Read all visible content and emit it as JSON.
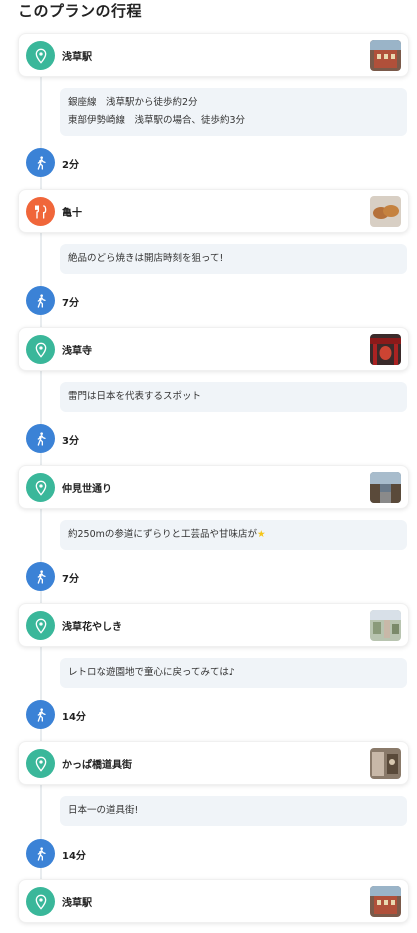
{
  "page": {
    "title": "このプランの行程"
  },
  "stops": [
    {
      "name": "浅草駅",
      "icon": "map-pin-icon",
      "color": "#3ab79a",
      "thumb": "station-photo",
      "note": [
        "銀座線　浅草駅から徒歩約2分",
        "東部伊勢崎線　浅草駅の場合、徒歩約3分"
      ]
    },
    {
      "name": "亀十",
      "icon": "fork-knife-icon",
      "color": "#f0663a",
      "thumb": "dorayaki-photo",
      "note": [
        "絶品のどら焼きは開店時刻を狙って!"
      ]
    },
    {
      "name": "浅草寺",
      "icon": "map-pin-icon",
      "color": "#3ab79a",
      "thumb": "temple-photo",
      "note": [
        "雷門は日本を代表するスポット"
      ]
    },
    {
      "name": "仲見世通り",
      "icon": "map-pin-icon",
      "color": "#3ab79a",
      "thumb": "street-photo",
      "note": [
        "約250mの参道にずらりと工芸品や甘味店が"
      ]
    },
    {
      "name": "浅草花やしき",
      "icon": "map-pin-icon",
      "color": "#3ab79a",
      "thumb": "amusement-park-photo",
      "note": [
        "レトロな遊園地で童心に戻ってみては♪"
      ]
    },
    {
      "name": "かっぱ橋道具街",
      "icon": "map-pin-icon",
      "color": "#3ab79a",
      "thumb": "tool-street-photo",
      "note": [
        "日本一の道具街!"
      ]
    },
    {
      "name": "浅草駅",
      "icon": "map-pin-icon",
      "color": "#3ab79a",
      "thumb": "station-photo",
      "note": []
    }
  ],
  "walks": [
    {
      "label": "2分",
      "icon": "walking-person-icon"
    },
    {
      "label": "7分",
      "icon": "walking-person-icon"
    },
    {
      "label": "3分",
      "icon": "walking-person-icon"
    },
    {
      "label": "7分",
      "icon": "walking-person-icon"
    },
    {
      "label": "14分",
      "icon": "walking-person-icon"
    },
    {
      "label": "14分",
      "icon": "walking-person-icon"
    }
  ]
}
